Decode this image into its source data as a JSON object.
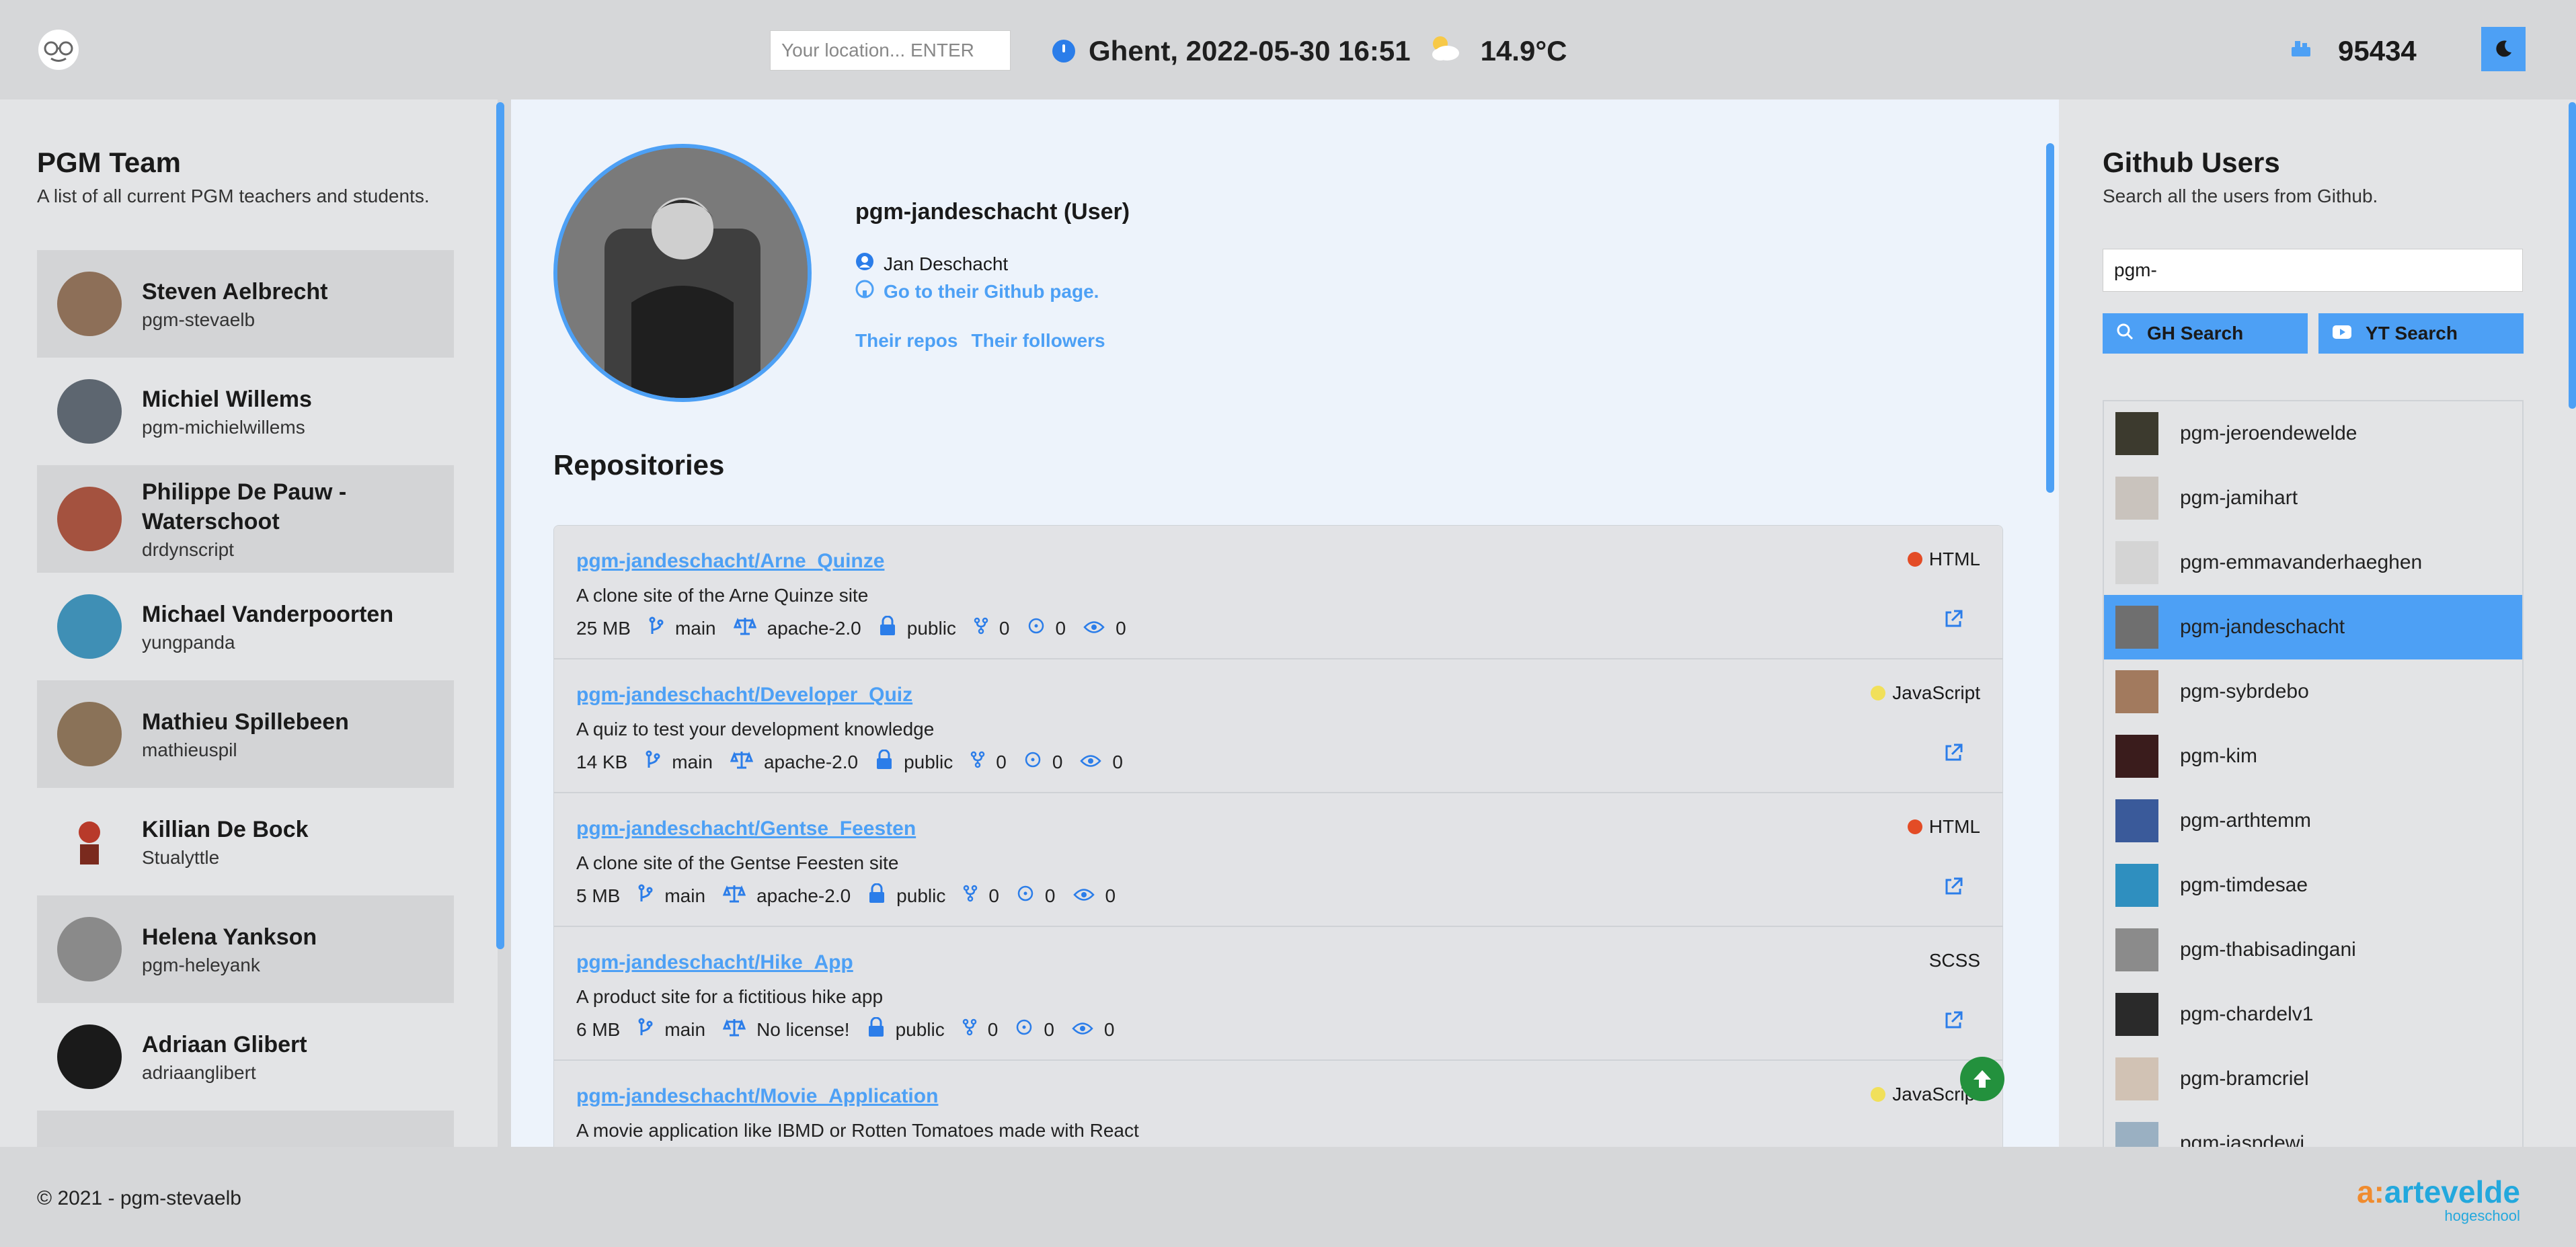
{
  "header": {
    "location_placeholder": "Your location... ENTER",
    "weather_text": "Ghent, 2022-05-30 16:51",
    "temperature": "14.9°C",
    "visitors": "95434"
  },
  "team": {
    "title": "PGM Team",
    "subtitle": "A list of all current PGM teachers and students.",
    "members": [
      {
        "name": "Steven Aelbrecht",
        "handle": "pgm-stevaelb"
      },
      {
        "name": "Michiel Willems",
        "handle": "pgm-michielwillems"
      },
      {
        "name": "Philippe De Pauw - Waterschoot",
        "handle": "drdynscript"
      },
      {
        "name": "Michael Vanderpoorten",
        "handle": "yungpanda"
      },
      {
        "name": "Mathieu Spillebeen",
        "handle": "mathieuspil"
      },
      {
        "name": "Killian De Bock",
        "handle": "Stualyttle"
      },
      {
        "name": "Helena Yankson",
        "handle": "pgm-heleyank"
      },
      {
        "name": "Adriaan Glibert",
        "handle": "adriaanglibert"
      }
    ]
  },
  "profile": {
    "username": "pgm-jandeschacht (User)",
    "full_name": "Jan Deschacht",
    "github_link": "Go to their Github page.",
    "repos_link": "Their repos",
    "followers_link": "Their followers"
  },
  "repositories": {
    "title": "Repositories",
    "items": [
      {
        "name": "pgm-jandeschacht/Arne_Quinze",
        "desc": "A clone site of the Arne Quinze site",
        "size": "25 MB",
        "branch": "main",
        "license": "apache-2.0",
        "visibility": "public",
        "forks": "0",
        "issues": "0",
        "watchers": "0",
        "lang": "HTML",
        "lang_color": "#e34c26"
      },
      {
        "name": "pgm-jandeschacht/Developer_Quiz",
        "desc": "A quiz to test your development knowledge",
        "size": "14 KB",
        "branch": "main",
        "license": "apache-2.0",
        "visibility": "public",
        "forks": "0",
        "issues": "0",
        "watchers": "0",
        "lang": "JavaScript",
        "lang_color": "#f1e05a"
      },
      {
        "name": "pgm-jandeschacht/Gentse_Feesten",
        "desc": "A clone site of the Gentse Feesten site",
        "size": "5 MB",
        "branch": "main",
        "license": "apache-2.0",
        "visibility": "public",
        "forks": "0",
        "issues": "0",
        "watchers": "0",
        "lang": "HTML",
        "lang_color": "#e34c26"
      },
      {
        "name": "pgm-jandeschacht/Hike_App",
        "desc": "A product site for a fictitious hike app",
        "size": "6 MB",
        "branch": "main",
        "license": "No license!",
        "visibility": "public",
        "forks": "0",
        "issues": "0",
        "watchers": "0",
        "lang": "SCSS",
        "lang_color": ""
      },
      {
        "name": "pgm-jandeschacht/Movie_Application",
        "desc": "A movie application like IBMD or Rotten Tomatoes made with React",
        "size": "",
        "branch": "",
        "license": "",
        "visibility": "",
        "forks": "",
        "issues": "",
        "watchers": "",
        "lang": "JavaScript",
        "lang_color": "#f1e05a"
      }
    ]
  },
  "github_users": {
    "title": "Github Users",
    "subtitle": "Search all the users from Github.",
    "search_value": "pgm-",
    "gh_button": "GH Search",
    "yt_button": "YT Search",
    "users": [
      "pgm-jeroendewelde",
      "pgm-jamihart",
      "pgm-emmavanderhaeghen",
      "pgm-jandeschacht",
      "pgm-sybrdebo",
      "pgm-kim",
      "pgm-arthtemm",
      "pgm-timdesae",
      "pgm-thabisadingani",
      "pgm-chardelv1",
      "pgm-bramcriel",
      "pgm-jaspdewi"
    ],
    "active_user": "pgm-jandeschacht"
  },
  "footer": {
    "copyright": "© 2021 - pgm-stevaelb",
    "brand_o": "a:",
    "brand_name": "artevelde",
    "brand_sub": "hogeschool"
  },
  "colors": {
    "accent": "#4da0f5",
    "to_top": "#23913d"
  }
}
